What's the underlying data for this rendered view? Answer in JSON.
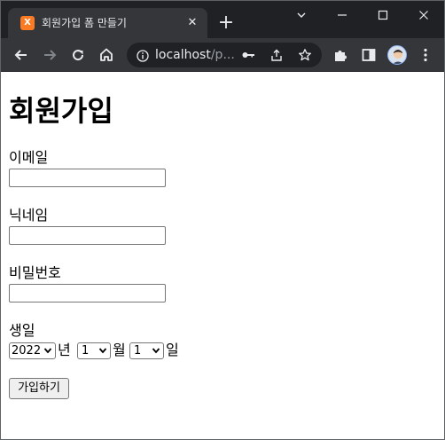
{
  "browser": {
    "tab_title": "회원가입 폼 만들기",
    "favicon_letter": "X",
    "url_host": "localhost",
    "url_rest": "/p..."
  },
  "page": {
    "title": "회원가입",
    "email_label": "이메일",
    "nickname_label": "닉네임",
    "password_label": "비밀번호",
    "birth_label": "생일",
    "year_value": "2022",
    "year_unit": "년",
    "month_value": "1",
    "month_unit": "월",
    "day_value": "1",
    "day_unit": "일",
    "submit_label": "가입하기"
  },
  "colors": {
    "tabstrip": "#202124",
    "toolbar": "#35363a",
    "accent": "#fb7a24"
  }
}
